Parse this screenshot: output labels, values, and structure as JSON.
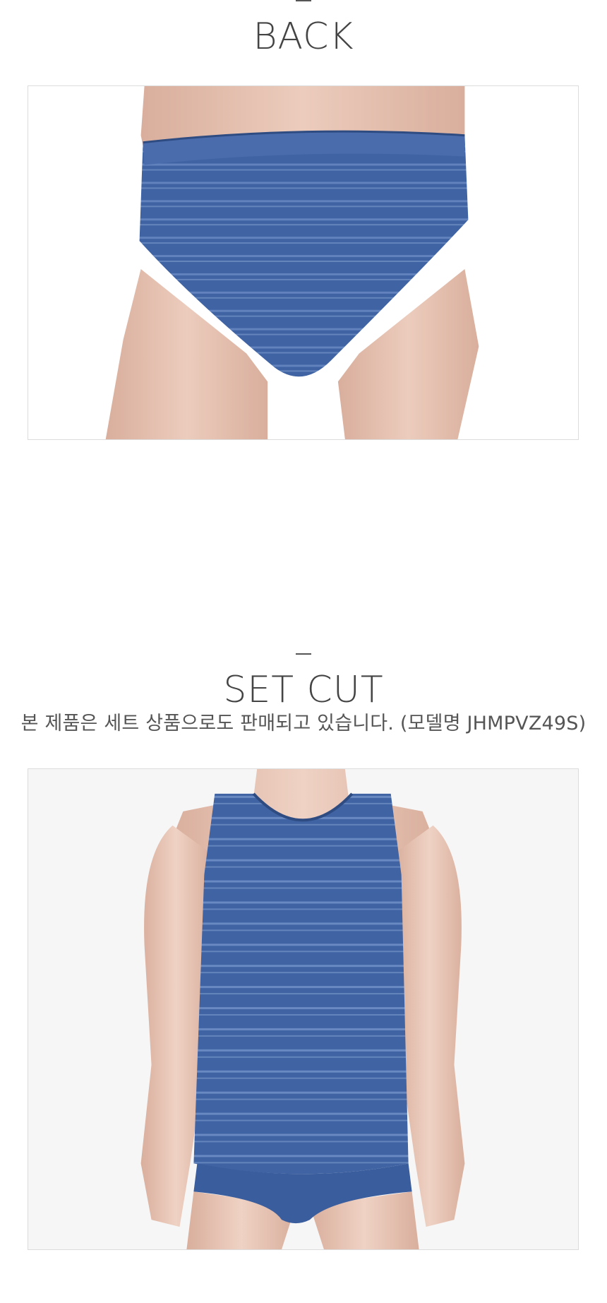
{
  "back_section": {
    "title": "BACK",
    "photo_alt": "back view of blue striped mesh briefs on mannequin"
  },
  "set_section": {
    "title": "SET CUT",
    "subtitle": "본 제품은 세트 상품으로도 판매되고 있습니다. (모델명 JHMPVZ49S)",
    "photo_alt": "front view of blue striped mesh tank top and briefs set on mannequin"
  },
  "colors": {
    "fabric": "#3f63a3",
    "fabric_dark": "#324f86",
    "skin": "#e8c7b8",
    "skin_shadow": "#d6aa97",
    "text": "#444444"
  }
}
